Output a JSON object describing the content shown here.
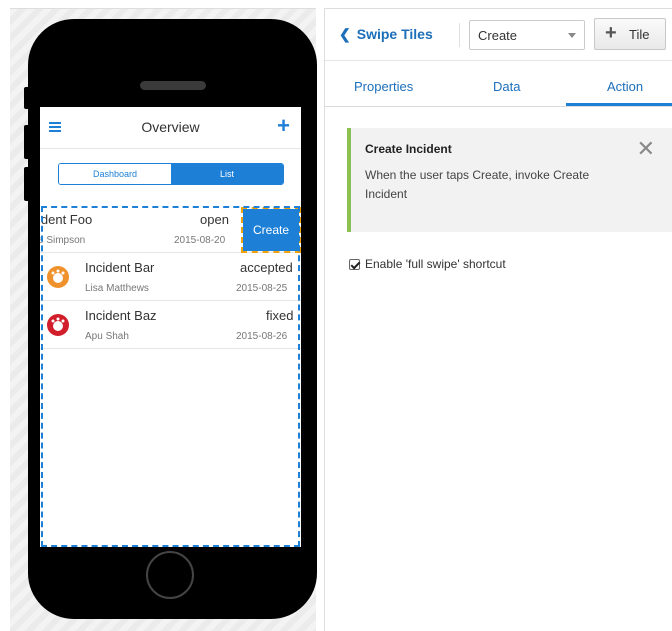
{
  "phone": {
    "nav": {
      "title": "Overview"
    },
    "segments": [
      {
        "label": "Dashboard",
        "active": false
      },
      {
        "label": "List",
        "active": true
      }
    ],
    "items": [
      {
        "title": "Incident Foo",
        "title_visible": "ident Foo",
        "status": "open",
        "person": "Homer Simpson",
        "person_visible": "e Simpson",
        "date": "2015-08-20"
      },
      {
        "title": "Incident Bar",
        "status": "accepted",
        "person": "Lisa Matthews",
        "date": "2015-08-25",
        "icon": "orange-gauge-icon"
      },
      {
        "title": "Incident Baz",
        "status": "fixed",
        "person": "Apu Shah",
        "date": "2015-08-26",
        "icon": "red-gauge-icon"
      }
    ],
    "swipe_action": {
      "label": "Create"
    }
  },
  "panel": {
    "back_label": "Swipe Tiles",
    "select_value": "Create",
    "tile_button_label": "Tile",
    "tabs": [
      {
        "label": "Properties",
        "active": false
      },
      {
        "label": "Data",
        "active": false
      },
      {
        "label": "Action",
        "active": true
      }
    ],
    "callout": {
      "title": "Create Incident",
      "text": "When the user taps Create, invoke Create Incident"
    },
    "checkbox": {
      "label": "Enable 'full swipe' shortcut",
      "checked": true
    }
  },
  "colors": {
    "accent": "#1d7fd6",
    "callout_border": "#8cc152",
    "highlight_outline": "#f0a30a"
  }
}
